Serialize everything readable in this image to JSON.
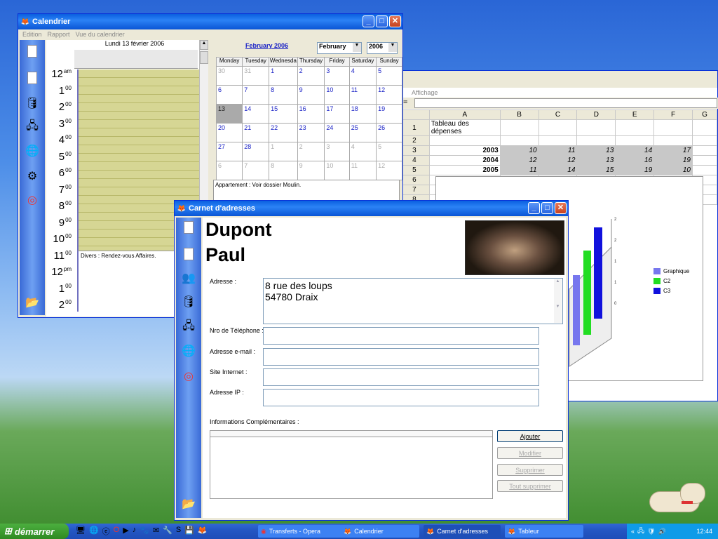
{
  "colors": {
    "accent": "#0a5fe0",
    "planner": "#d6d694",
    "chart_c1": "#7777ee",
    "chart_c2": "#22dd22",
    "chart_c3": "#1111dd"
  },
  "calendar": {
    "title": "Calendrier",
    "menu": [
      "Edition",
      "Rapport",
      "Vue du calendrier"
    ],
    "day_header": "Lundi 13 février 2006",
    "hours": [
      {
        "h": "12",
        "s": "am"
      },
      {
        "h": "1",
        "s": "00"
      },
      {
        "h": "2",
        "s": "00"
      },
      {
        "h": "3",
        "s": "00"
      },
      {
        "h": "4",
        "s": "00"
      },
      {
        "h": "5",
        "s": "00"
      },
      {
        "h": "6",
        "s": "00"
      },
      {
        "h": "7",
        "s": "00"
      },
      {
        "h": "8",
        "s": "00"
      },
      {
        "h": "9",
        "s": "00"
      },
      {
        "h": "10",
        "s": "00"
      },
      {
        "h": "11",
        "s": "00"
      },
      {
        "h": "12",
        "s": "pm"
      },
      {
        "h": "1",
        "s": "00"
      },
      {
        "h": "2",
        "s": "00"
      }
    ],
    "event": "Divers : Rendez-vous Affaires.",
    "month_link": "February 2006",
    "month_select": "February",
    "year_select": "2006",
    "weekdays": [
      "Monday",
      "Tuesday",
      "Wednesda",
      "Thursday",
      "Friday",
      "Saturday",
      "Sunday"
    ],
    "weeks": [
      [
        "30",
        "31",
        "1",
        "2",
        "3",
        "4",
        "5"
      ],
      [
        "6",
        "7",
        "8",
        "9",
        "10",
        "11",
        "12"
      ],
      [
        "13",
        "14",
        "15",
        "16",
        "17",
        "18",
        "19"
      ],
      [
        "20",
        "21",
        "22",
        "23",
        "24",
        "25",
        "26"
      ],
      [
        "27",
        "28",
        "1",
        "2",
        "3",
        "4",
        "5"
      ],
      [
        "6",
        "7",
        "8",
        "9",
        "10",
        "11",
        "12"
      ]
    ],
    "note": "Appartement : Voir dossier Moulin."
  },
  "sheet": {
    "menu": "Affichage",
    "cols": [
      "A",
      "B",
      "C",
      "D",
      "E",
      "F",
      "G"
    ],
    "rows": [
      {
        "n": "1",
        "a": "Tableau des dépenses",
        "v": [
          "",
          "",
          "",
          "",
          ""
        ]
      },
      {
        "n": "2",
        "a": "",
        "v": [
          "",
          "",
          "",
          "",
          ""
        ]
      },
      {
        "n": "3",
        "a": "2003",
        "v": [
          "10",
          "11",
          "13",
          "14",
          "17"
        ]
      },
      {
        "n": "4",
        "a": "2004",
        "v": [
          "12",
          "12",
          "13",
          "16",
          "19"
        ]
      },
      {
        "n": "5",
        "a": "2005",
        "v": [
          "11",
          "14",
          "15",
          "19",
          "10"
        ]
      },
      {
        "n": "6",
        "a": "",
        "v": [
          "",
          "",
          "",
          "",
          ""
        ]
      },
      {
        "n": "7",
        "a": "",
        "v": [
          "",
          "",
          "",
          "",
          ""
        ]
      },
      {
        "n": "8",
        "a": "",
        "v": [
          "",
          "",
          "",
          "",
          ""
        ]
      }
    ],
    "legend": [
      "Graphique",
      "C2",
      "C3"
    ]
  },
  "addr": {
    "title": "Carnet d'adresses",
    "last": "Dupont",
    "first": "Paul",
    "address_label": "Adresse :",
    "address_line1": "8 rue des loups",
    "address_line2": "54780 Draix",
    "phone_label": "Nro de Téléphone :",
    "email_label": "Adresse e-mail :",
    "site_label": "Site Internet :",
    "ip_label": "Adresse IP :",
    "info_label": "Informations Complémentaires :",
    "btn_add": "Ajouter",
    "btn_edit": "Modifier",
    "btn_delete": "Supprimer",
    "btn_delete_all": "Tout supprimer"
  },
  "taskbar": {
    "start": "démarrer",
    "tasks": [
      "Transferts - Opera",
      "Calendrier",
      "Carnet d'adresses",
      "Tableur"
    ],
    "clock": "12:44"
  }
}
